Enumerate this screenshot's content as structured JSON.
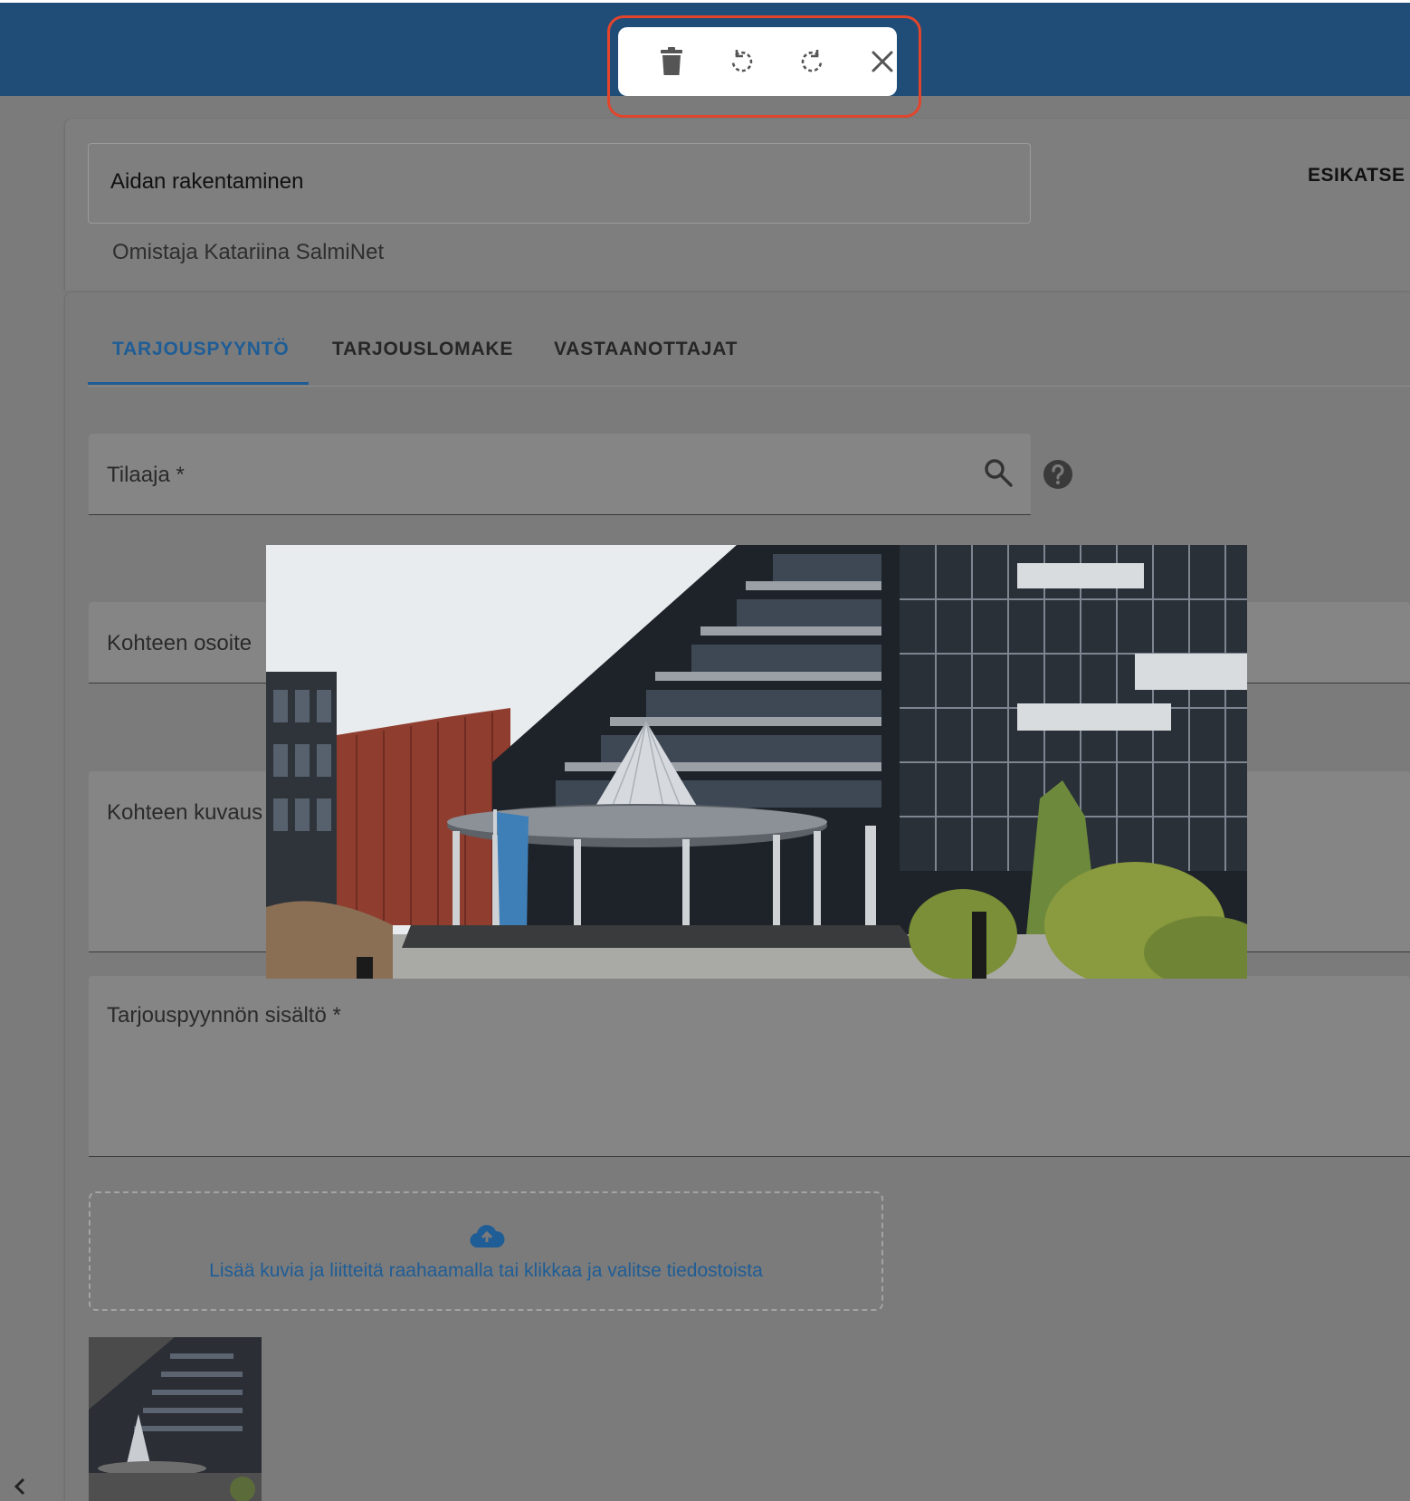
{
  "toolbar": {
    "actions": [
      "trash-icon",
      "rotate-left-icon",
      "rotate-right-icon",
      "close-icon"
    ],
    "highlight_color": "#e2452c"
  },
  "header": {
    "title": "Aidan rakentaminen",
    "owner": "Omistaja Katariina SalmiNet",
    "preview_label": "ESIKATSE"
  },
  "tabs": [
    {
      "label": "TARJOUSPYYNTÖ",
      "active": true
    },
    {
      "label": "TARJOUSLOMAKE",
      "active": false
    },
    {
      "label": "VASTAANOTTAJAT",
      "active": false
    }
  ],
  "form": {
    "tilaaja_label": "Tilaaja *",
    "osoite_label": "Kohteen osoite",
    "kuvaus_label": "Kohteen kuvaus",
    "sisalto_label": "Tarjouspyynnön sisältö *"
  },
  "upload": {
    "text": "Lisää kuvia ja liitteitä raahaamalla tai klikkaa ja valitse tiedostoista"
  },
  "colors": {
    "topbar": "#1f4d78",
    "accent": "#1f5d96",
    "overlay": "#7b7b7b"
  }
}
